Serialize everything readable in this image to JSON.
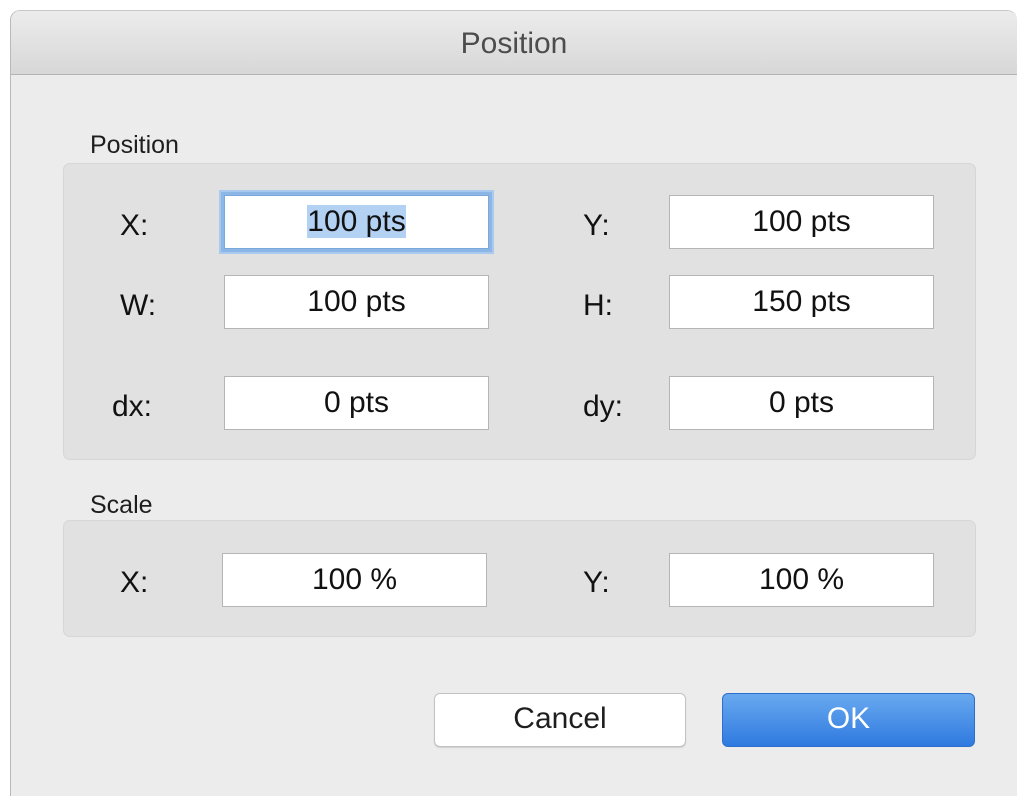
{
  "window": {
    "title": "Position"
  },
  "position_section": {
    "label": "Position",
    "x_label": "X:",
    "x_value": "100 pts",
    "y_label": "Y:",
    "y_value": "100 pts",
    "w_label": "W:",
    "w_value": "100 pts",
    "h_label": "H:",
    "h_value": "150 pts",
    "dx_label": "dx:",
    "dx_value": "0 pts",
    "dy_label": "dy:",
    "dy_value": "0 pts"
  },
  "scale_section": {
    "label": "Scale",
    "x_label": "X:",
    "x_value": "100 %",
    "y_label": "Y:",
    "y_value": "100 %"
  },
  "buttons": {
    "cancel_label": "Cancel",
    "ok_label": "OK"
  },
  "colors": {
    "focus_ring": "#8bb6e6",
    "selection": "#b3d1f2",
    "ok_button": "#3b86e5"
  }
}
